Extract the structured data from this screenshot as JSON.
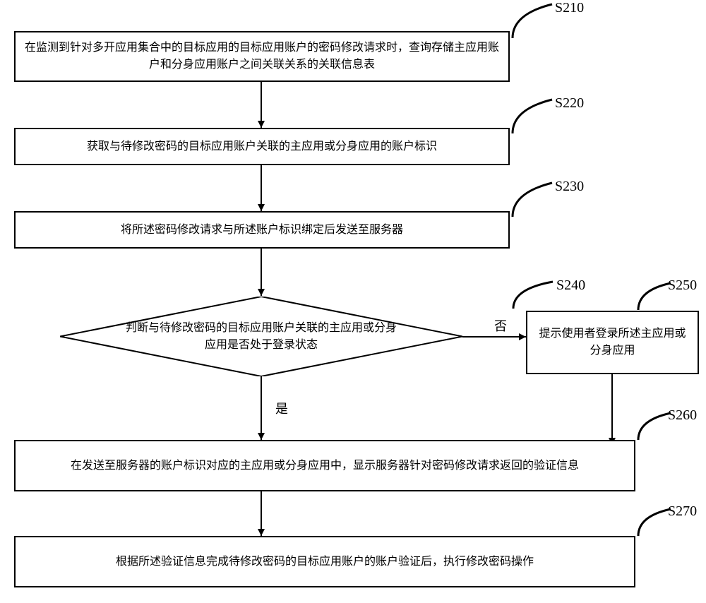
{
  "steps": {
    "s210": {
      "label": "S210",
      "text": "在监测到针对多开应用集合中的目标应用的目标应用账户的密码修改请求时，查询存储主应用账户和分身应用账户之间关联关系的关联信息表"
    },
    "s220": {
      "label": "S220",
      "text": "获取与待修改密码的目标应用账户关联的主应用或分身应用的账户标识"
    },
    "s230": {
      "label": "S230",
      "text": "将所述密码修改请求与所述账户标识绑定后发送至服务器"
    },
    "s240": {
      "label": "S240",
      "text": "判断与待修改密码的目标应用账户关联的主应用或分身应用是否处于登录状态"
    },
    "s250": {
      "label": "S250",
      "text": "提示使用者登录所述主应用或分身应用"
    },
    "s260": {
      "label": "S260",
      "text": "在发送至服务器的账户标识对应的主应用或分身应用中，显示服务器针对密码修改请求返回的验证信息"
    },
    "s270": {
      "label": "S270",
      "text": "根据所述验证信息完成待修改密码的目标应用账户的账户验证后，执行修改密码操作"
    }
  },
  "edges": {
    "yes": "是",
    "no": "否"
  }
}
